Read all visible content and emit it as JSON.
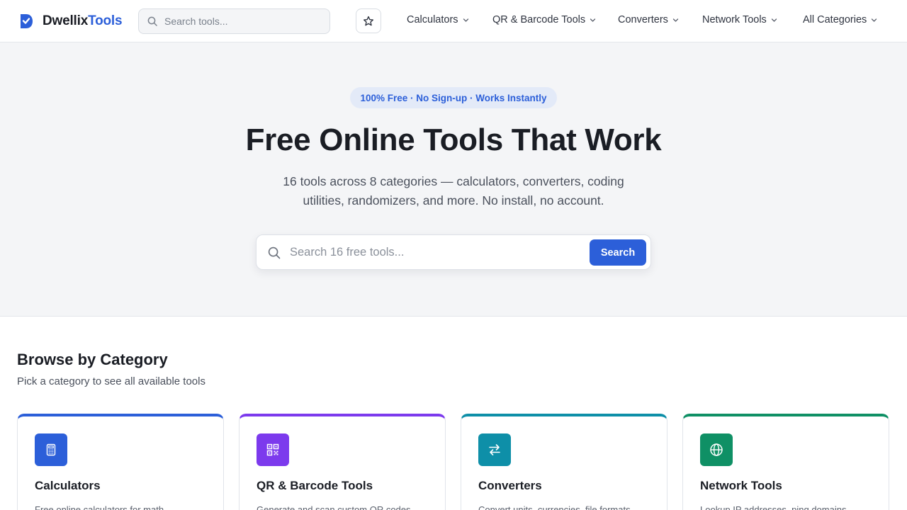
{
  "header": {
    "logo_part1": "Dwellix",
    "logo_part2": "Tools",
    "search_placeholder": "Search tools...",
    "nav": [
      {
        "label": "Calculators"
      },
      {
        "label": "QR & Barcode Tools"
      },
      {
        "label": "Converters"
      },
      {
        "label": "Network Tools"
      },
      {
        "label": "All Categories"
      }
    ]
  },
  "hero": {
    "badge": "100% Free · No Sign-up · Works Instantly",
    "title": "Free Online Tools That Work",
    "subtitle": "16 tools across 8 categories — calculators, converters, coding utilities, randomizers, and more. No install, no account.",
    "search_placeholder": "Search 16 free tools...",
    "search_button": "Search"
  },
  "categories": {
    "title": "Browse by Category",
    "subtitle": "Pick a category to see all available tools",
    "cards": [
      {
        "title": "Calculators",
        "desc": "Free online calculators for math,",
        "icon": "calculator-icon",
        "color": "#2c5fd9"
      },
      {
        "title": "QR & Barcode Tools",
        "desc": "Generate and scan custom QR codes",
        "icon": "qr-code-icon",
        "color": "#7c3aed"
      },
      {
        "title": "Converters",
        "desc": "Convert units, currencies, file formats",
        "icon": "arrows-swap-icon",
        "color": "#0e8fa8"
      },
      {
        "title": "Network Tools",
        "desc": "Lookup IP addresses, ping domains",
        "icon": "globe-icon",
        "color": "#0f9065"
      }
    ]
  },
  "colors": {
    "accent": "#2c5fd9",
    "hero_bg": "#f4f5f7"
  }
}
